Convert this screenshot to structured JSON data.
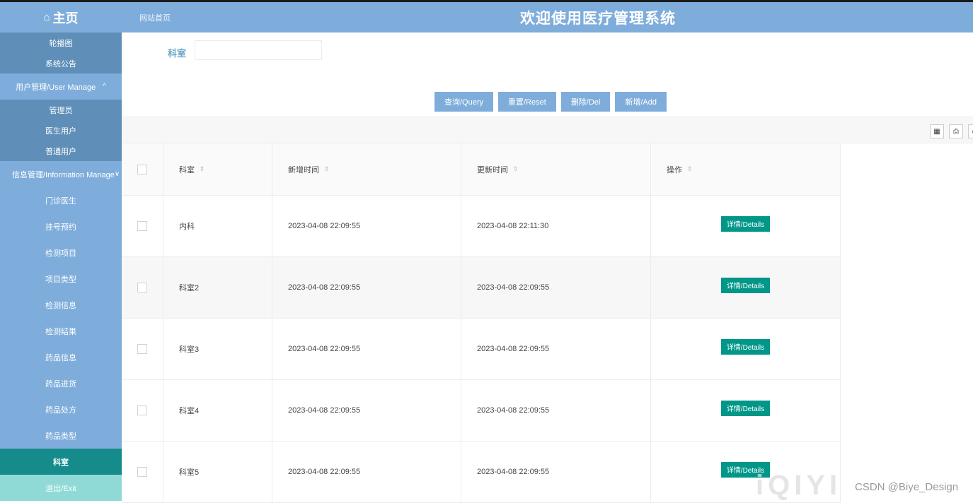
{
  "header": {
    "brand": "主页",
    "breadcrumb": "网站首页",
    "title": "欢迎使用医疗管理系统"
  },
  "sidebar": {
    "items": [
      {
        "label": "轮播图"
      },
      {
        "label": "系统公告"
      }
    ],
    "user_group": {
      "label": "用户管理/User Manage",
      "arrow": "^"
    },
    "user_items": [
      {
        "label": "管理员"
      },
      {
        "label": "医生用户"
      },
      {
        "label": "普通用户"
      }
    ],
    "info_group": {
      "label": "信息管理/Information Manage",
      "arrow": "∨"
    },
    "info_items": [
      {
        "label": "门诊医生"
      },
      {
        "label": "挂号预约"
      },
      {
        "label": "检测项目"
      },
      {
        "label": "项目类型"
      },
      {
        "label": "检测信息"
      },
      {
        "label": "检测结果"
      },
      {
        "label": "药品信息"
      },
      {
        "label": "药品进货"
      },
      {
        "label": "药品处方"
      },
      {
        "label": "药品类型"
      }
    ],
    "active": {
      "label": "科室"
    },
    "exit": {
      "label": "退出/Exit"
    }
  },
  "search": {
    "label": "科室",
    "value": ""
  },
  "buttons": {
    "query": "查询/Query",
    "reset": "重置/Reset",
    "delete": "删除/Del",
    "add": "新增/Add"
  },
  "table": {
    "columns": [
      "科室",
      "新增时间",
      "更新时间",
      "操作"
    ],
    "sort_icon": "⇳",
    "detail_label": "详情/Details",
    "rows": [
      {
        "name": "内科",
        "created": "2023-04-08 22:09:55",
        "updated": "2023-04-08 22:11:30"
      },
      {
        "name": "科室2",
        "created": "2023-04-08 22:09:55",
        "updated": "2023-04-08 22:09:55"
      },
      {
        "name": "科室3",
        "created": "2023-04-08 22:09:55",
        "updated": "2023-04-08 22:09:55"
      },
      {
        "name": "科室4",
        "created": "2023-04-08 22:09:55",
        "updated": "2023-04-08 22:09:55"
      },
      {
        "name": "科室5",
        "created": "2023-04-08 22:09:55",
        "updated": "2023-04-08 22:09:55"
      }
    ]
  },
  "watermark": {
    "logo": "iQIYI",
    "text": "CSDN @Biye_Design"
  }
}
